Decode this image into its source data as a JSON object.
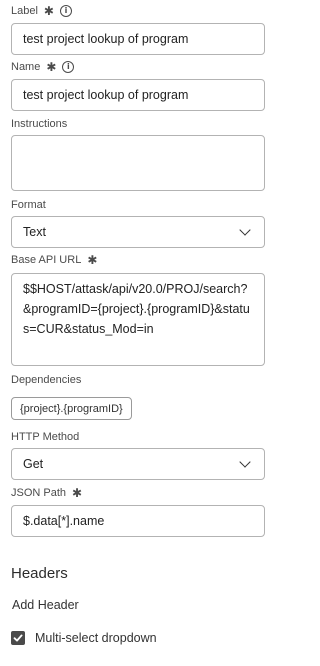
{
  "fields": {
    "label": {
      "label": "Label",
      "required_mark": "✱",
      "value": "test project lookup of program"
    },
    "name": {
      "label": "Name",
      "required_mark": "✱",
      "value": "test project lookup of program"
    },
    "instructions": {
      "label": "Instructions",
      "value": ""
    },
    "format": {
      "label": "Format",
      "value": "Text"
    },
    "base_api_url": {
      "label": "Base API URL",
      "required_mark": "✱",
      "value": "$$HOST/attask/api/v20.0/PROJ/search?&programID={project}.{programID}&status=CUR&status_Mod=in"
    },
    "dependencies": {
      "label": "Dependencies",
      "tag": "{project}.{programID}"
    },
    "http_method": {
      "label": "HTTP Method",
      "value": "Get"
    },
    "json_path": {
      "label": "JSON Path",
      "required_mark": "✱",
      "value": "$.data[*].name"
    }
  },
  "headers": {
    "title": "Headers",
    "add_label": "Add Header"
  },
  "multi_select": {
    "label": "Multi-select dropdown",
    "checked": true
  },
  "icons": {
    "info": "info-icon",
    "chevron": "chevron-down-icon",
    "check": "checkmark-icon"
  }
}
